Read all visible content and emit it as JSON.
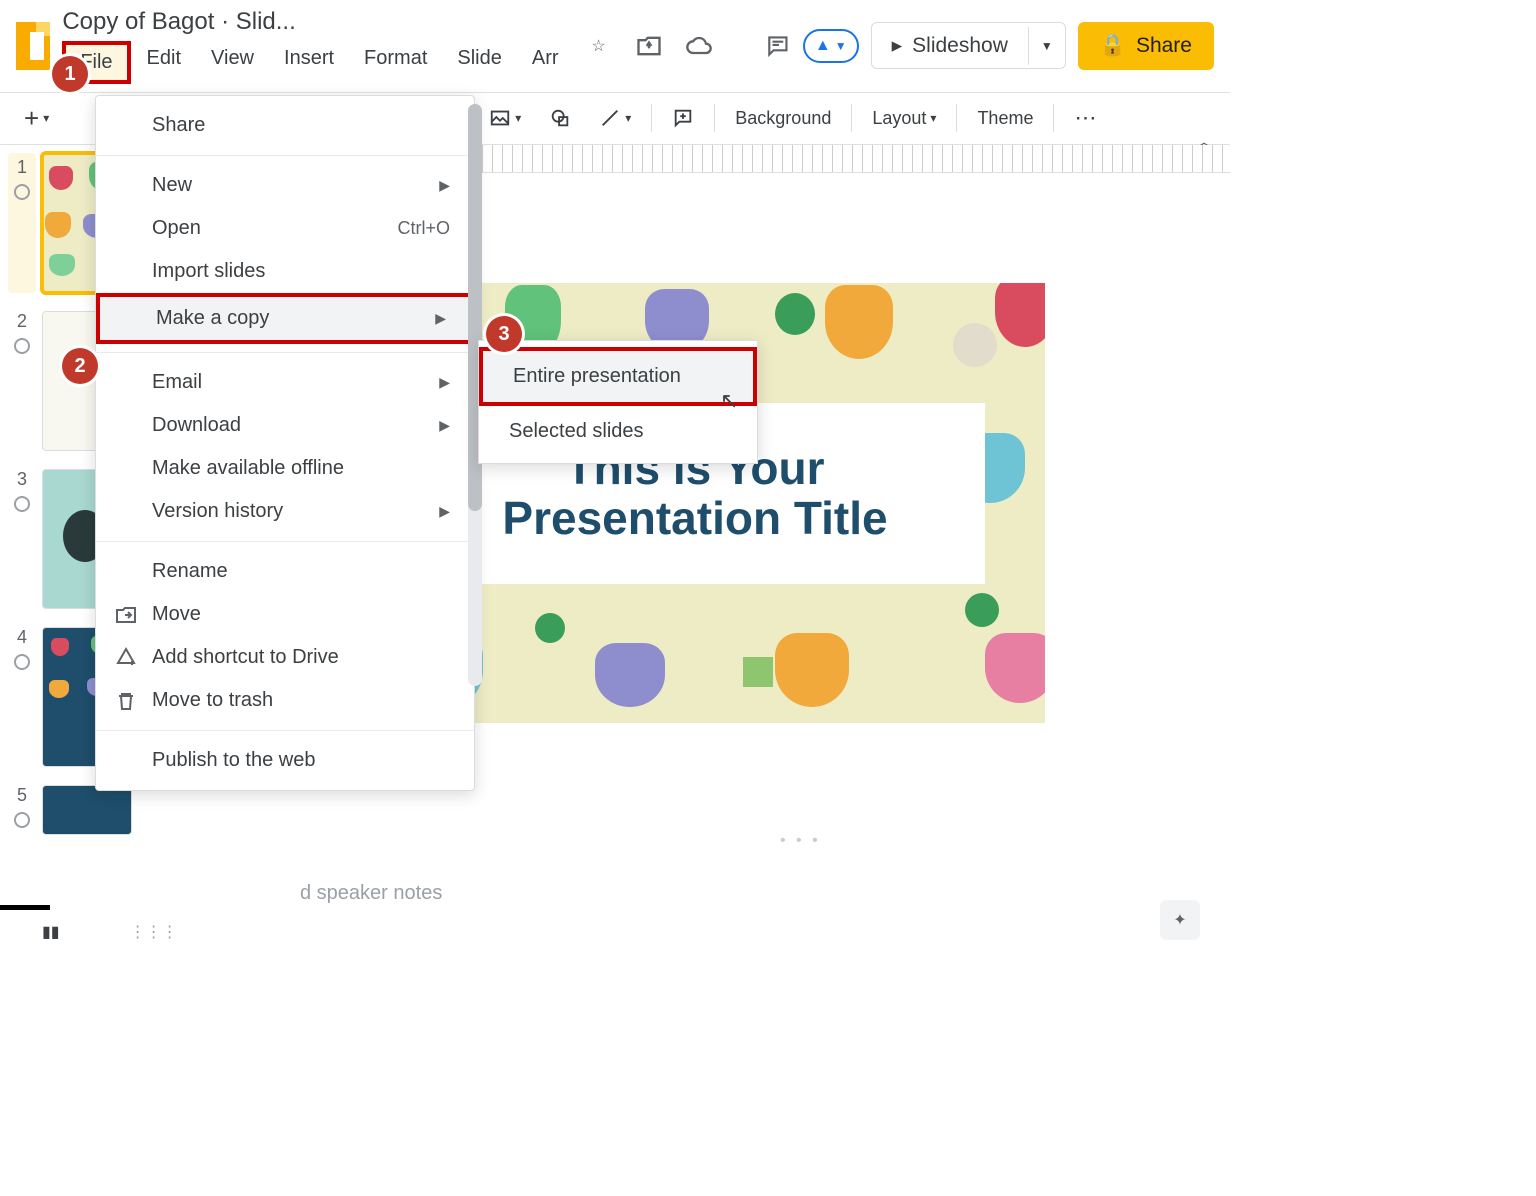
{
  "doc_title": "Copy of Bagot · Slid...",
  "menubar": {
    "file": "File",
    "edit": "Edit",
    "view": "View",
    "insert": "Insert",
    "format": "Format",
    "slide": "Slide",
    "arr": "Arr"
  },
  "header_buttons": {
    "slideshow": "Slideshow",
    "share": "Share"
  },
  "toolbar": {
    "background": "Background",
    "layout": "Layout",
    "theme": "Theme"
  },
  "file_menu": {
    "share": "Share",
    "new": "New",
    "open": "Open",
    "open_shortcut": "Ctrl+O",
    "import": "Import slides",
    "make_copy": "Make a copy",
    "email": "Email",
    "download": "Download",
    "offline": "Make available offline",
    "version": "Version history",
    "rename": "Rename",
    "move": "Move",
    "shortcut": "Add shortcut to Drive",
    "trash": "Move to trash",
    "publish": "Publish to the web"
  },
  "submenu": {
    "entire": "Entire presentation",
    "selected": "Selected slides"
  },
  "slide_title": "This is Your Presentation Title",
  "speaker_notes": "d speaker notes",
  "annotations": {
    "a1": "1",
    "a2": "2",
    "a3": "3"
  },
  "thumbs": [
    "1",
    "2",
    "3",
    "4",
    "5"
  ],
  "colors": {
    "brand": "#fbbc04",
    "blue": "#1a73e8",
    "highlight": "#cc0000",
    "annot": "#c0392b"
  }
}
